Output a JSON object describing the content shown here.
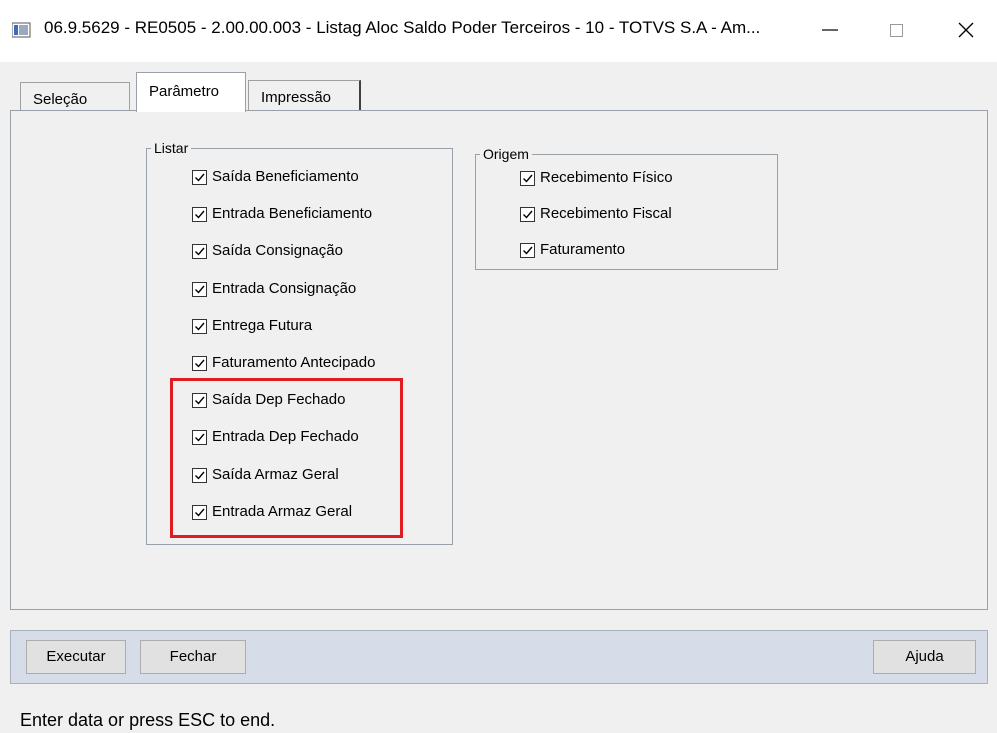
{
  "window": {
    "title": "06.9.5629 - RE0505 - 2.00.00.003 - Listag Aloc Saldo Poder Terceiros - 10 - TOTVS S.A - Am...",
    "minimize_symbol": "—",
    "maximize_symbol": "☐",
    "close_symbol": "✕"
  },
  "tabs": [
    {
      "label": "Seleção",
      "active": false
    },
    {
      "label": "Parâmetro",
      "active": true
    },
    {
      "label": "Impressão",
      "active": false
    }
  ],
  "listar": {
    "legend": "Listar",
    "items": [
      {
        "label": "Saída Beneficiamento",
        "checked": true
      },
      {
        "label": "Entrada Beneficiamento",
        "checked": true
      },
      {
        "label": "Saída Consignação",
        "checked": true
      },
      {
        "label": "Entrada Consignação",
        "checked": true
      },
      {
        "label": "Entrega Futura",
        "checked": true
      },
      {
        "label": "Faturamento Antecipado",
        "checked": true
      },
      {
        "label": "Saída Dep Fechado",
        "checked": true
      },
      {
        "label": "Entrada Dep Fechado",
        "checked": true
      },
      {
        "label": "Saída Armaz Geral",
        "checked": true
      },
      {
        "label": "Entrada Armaz Geral",
        "checked": true
      }
    ]
  },
  "origem": {
    "legend": "Origem",
    "items": [
      {
        "label": "Recebimento Físico",
        "checked": true
      },
      {
        "label": "Recebimento Fiscal",
        "checked": true
      },
      {
        "label": "Faturamento",
        "checked": true
      }
    ]
  },
  "buttons": {
    "executar": "Executar",
    "fechar": "Fechar",
    "ajuda": "Ajuda"
  },
  "status_text": "Enter data or press ESC to end.",
  "colors": {
    "highlight": "#e11b22",
    "button_bar": "#d6dde8"
  }
}
